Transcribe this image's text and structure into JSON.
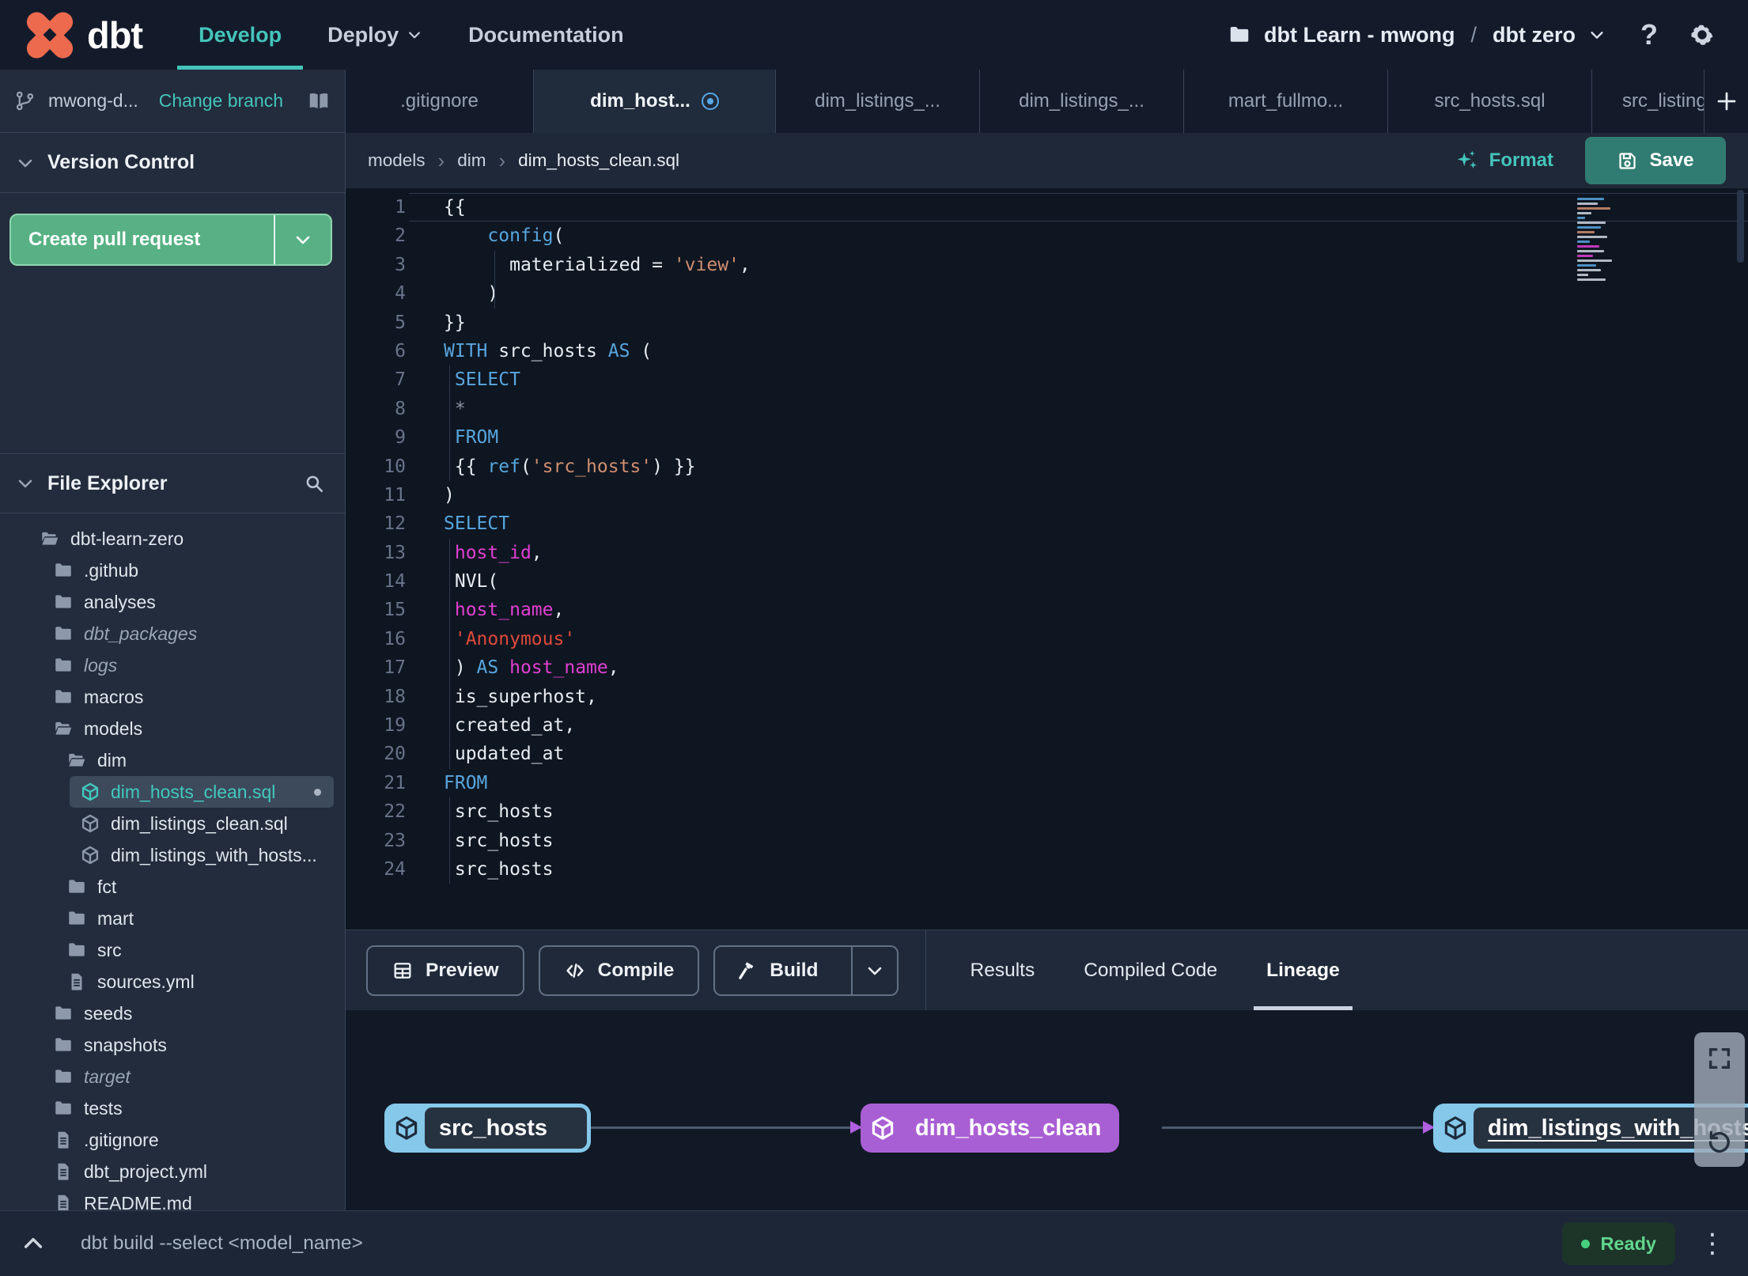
{
  "colors": {
    "teal_accent": "#45c4ba",
    "logo_orange": "#ee6a4e",
    "green_button": "#57b184",
    "save_teal": "#317c72",
    "keyword_blue": "#58a6df",
    "string_orange": "#cf8e70",
    "error_red": "#e0493a",
    "column_magenta": "#e13fd2",
    "lineage_purple": "#a95fd4",
    "lineage_blue": "#85c8ea",
    "ready_green": "#62d68e"
  },
  "topnav": {
    "logo_text": "dbt",
    "menu": [
      {
        "label": "Develop",
        "active": true
      },
      {
        "label": "Deploy",
        "caret": true
      },
      {
        "label": "Documentation"
      }
    ],
    "project_name": "dbt Learn - mwong",
    "project_separator": "/",
    "environment": "dbt zero"
  },
  "sidebar": {
    "branch_name": "mwong-d...",
    "change_branch_label": "Change branch",
    "version_control_title": "Version Control",
    "create_pr_label": "Create pull request",
    "file_explorer_title": "File Explorer",
    "tree": [
      {
        "label": "dbt-learn-zero",
        "icon": "folder-open",
        "depth": 0
      },
      {
        "label": ".github",
        "icon": "folder",
        "depth": 1
      },
      {
        "label": "analyses",
        "icon": "folder",
        "depth": 1
      },
      {
        "label": "dbt_packages",
        "icon": "folder",
        "depth": 1,
        "italic": true
      },
      {
        "label": "logs",
        "icon": "folder",
        "depth": 1,
        "italic": true
      },
      {
        "label": "macros",
        "icon": "folder",
        "depth": 1
      },
      {
        "label": "models",
        "icon": "folder-open",
        "depth": 1
      },
      {
        "label": "dim",
        "icon": "folder-open",
        "depth": 2
      },
      {
        "label": "dim_hosts_clean.sql",
        "icon": "cube",
        "depth": 3,
        "selected": true,
        "modified": true
      },
      {
        "label": "dim_listings_clean.sql",
        "icon": "cube",
        "depth": 3
      },
      {
        "label": "dim_listings_with_hosts...",
        "icon": "cube",
        "depth": 3
      },
      {
        "label": "fct",
        "icon": "folder",
        "depth": 2
      },
      {
        "label": "mart",
        "icon": "folder",
        "depth": 2
      },
      {
        "label": "src",
        "icon": "folder",
        "depth": 2
      },
      {
        "label": "sources.yml",
        "icon": "file",
        "depth": 2
      },
      {
        "label": "seeds",
        "icon": "folder",
        "depth": 1
      },
      {
        "label": "snapshots",
        "icon": "folder",
        "depth": 1
      },
      {
        "label": "target",
        "icon": "folder",
        "depth": 1,
        "italic": true
      },
      {
        "label": "tests",
        "icon": "folder",
        "depth": 1
      },
      {
        "label": ".gitignore",
        "icon": "file",
        "depth": 1
      },
      {
        "label": "dbt_project.yml",
        "icon": "file",
        "depth": 1
      },
      {
        "label": "README.md",
        "icon": "file",
        "depth": 1
      }
    ]
  },
  "tabs": [
    {
      "label": ".gitignore"
    },
    {
      "label": "dim_host...",
      "active": true,
      "modified": true
    },
    {
      "label": "dim_listings_..."
    },
    {
      "label": "dim_listings_..."
    },
    {
      "label": "mart_fullmo..."
    },
    {
      "label": "src_hosts.sql"
    },
    {
      "label": "src_listings."
    }
  ],
  "editor": {
    "breadcrumb": [
      "models",
      "dim",
      "dim_hosts_clean.sql"
    ],
    "format_label": "Format",
    "save_label": "Save",
    "code_lines": [
      {
        "tokens": [
          [
            "{{",
            "d"
          ]
        ],
        "current": true
      },
      {
        "tokens": [
          [
            "    ",
            "d"
          ],
          [
            "config",
            "k"
          ],
          [
            "(",
            "d"
          ]
        ]
      },
      {
        "tokens": [
          [
            "      ",
            "d"
          ],
          [
            "materialized = ",
            "d"
          ],
          [
            "'view'",
            "s"
          ],
          [
            ",",
            "d"
          ]
        ],
        "guides": [
          4.6
        ]
      },
      {
        "tokens": [
          [
            "    )",
            "d"
          ]
        ],
        "guides": [
          4.6
        ]
      },
      {
        "tokens": [
          [
            "}}",
            "d"
          ]
        ]
      },
      {
        "tokens": [
          [
            "WITH",
            "k"
          ],
          [
            " src_hosts ",
            "d"
          ],
          [
            "AS",
            "k"
          ],
          [
            " (",
            "d"
          ]
        ]
      },
      {
        "tokens": [
          [
            " ",
            "d"
          ],
          [
            "SELECT",
            "k"
          ]
        ],
        "guides": [
          0.5
        ]
      },
      {
        "tokens": [
          [
            " ",
            "d"
          ],
          [
            "*",
            "g"
          ]
        ],
        "guides": [
          0.5
        ]
      },
      {
        "tokens": [
          [
            " ",
            "d"
          ],
          [
            "FROM",
            "k"
          ]
        ],
        "guides": [
          0.5
        ]
      },
      {
        "tokens": [
          [
            " {{ ",
            "d"
          ],
          [
            "ref",
            "k"
          ],
          [
            "(",
            "d"
          ],
          [
            "'src_hosts'",
            "s"
          ],
          [
            ") }}",
            "d"
          ]
        ],
        "guides": [
          0.5
        ]
      },
      {
        "tokens": [
          [
            ")",
            "d"
          ]
        ]
      },
      {
        "tokens": [
          [
            "SELECT",
            "k"
          ]
        ]
      },
      {
        "tokens": [
          [
            " ",
            "d"
          ],
          [
            "host_id",
            "c"
          ],
          [
            ",",
            "d"
          ]
        ],
        "guides": [
          0.5
        ]
      },
      {
        "tokens": [
          [
            " NVL(",
            "d"
          ]
        ],
        "guides": [
          0.5
        ]
      },
      {
        "tokens": [
          [
            " ",
            "d"
          ],
          [
            "host_name",
            "c"
          ],
          [
            ",",
            "d"
          ]
        ],
        "guides": [
          0.5
        ]
      },
      {
        "tokens": [
          [
            " ",
            "d"
          ],
          [
            "'Anonymous'",
            "r"
          ]
        ],
        "guides": [
          0.5
        ]
      },
      {
        "tokens": [
          [
            " ) ",
            "d"
          ],
          [
            "AS",
            "k"
          ],
          [
            " ",
            "d"
          ],
          [
            "host_name",
            "c"
          ],
          [
            ",",
            "d"
          ]
        ],
        "guides": [
          0.5
        ]
      },
      {
        "tokens": [
          [
            " is_superhost,",
            "d"
          ]
        ],
        "guides": [
          0.5
        ]
      },
      {
        "tokens": [
          [
            " created_at,",
            "d"
          ]
        ],
        "guides": [
          0.5
        ]
      },
      {
        "tokens": [
          [
            " updated_at",
            "d"
          ]
        ],
        "guides": [
          0.5
        ]
      },
      {
        "tokens": [
          [
            "FROM",
            "k"
          ]
        ]
      },
      {
        "tokens": [
          [
            " src_hosts",
            "d"
          ]
        ],
        "guides": [
          0.5
        ]
      },
      {
        "tokens": [
          [
            " src_hosts",
            "d"
          ]
        ],
        "guides": [
          0.5
        ]
      },
      {
        "tokens": [
          [
            " src_hosts",
            "d"
          ]
        ],
        "guides": [
          0.5
        ]
      }
    ]
  },
  "panel": {
    "preview_label": "Preview",
    "compile_label": "Compile",
    "build_label": "Build",
    "tabs": [
      {
        "label": "Results"
      },
      {
        "label": "Compiled Code"
      },
      {
        "label": "Lineage",
        "active": true
      }
    ]
  },
  "lineage": {
    "nodes": [
      {
        "label": "src_hosts",
        "style": "source"
      },
      {
        "label": "dim_hosts_clean",
        "style": "selected"
      },
      {
        "label": "dim_listings_with_hosts",
        "style": "source",
        "clipped": true
      }
    ]
  },
  "statusbar": {
    "command": "dbt build --select <model_name>",
    "status": "Ready"
  }
}
